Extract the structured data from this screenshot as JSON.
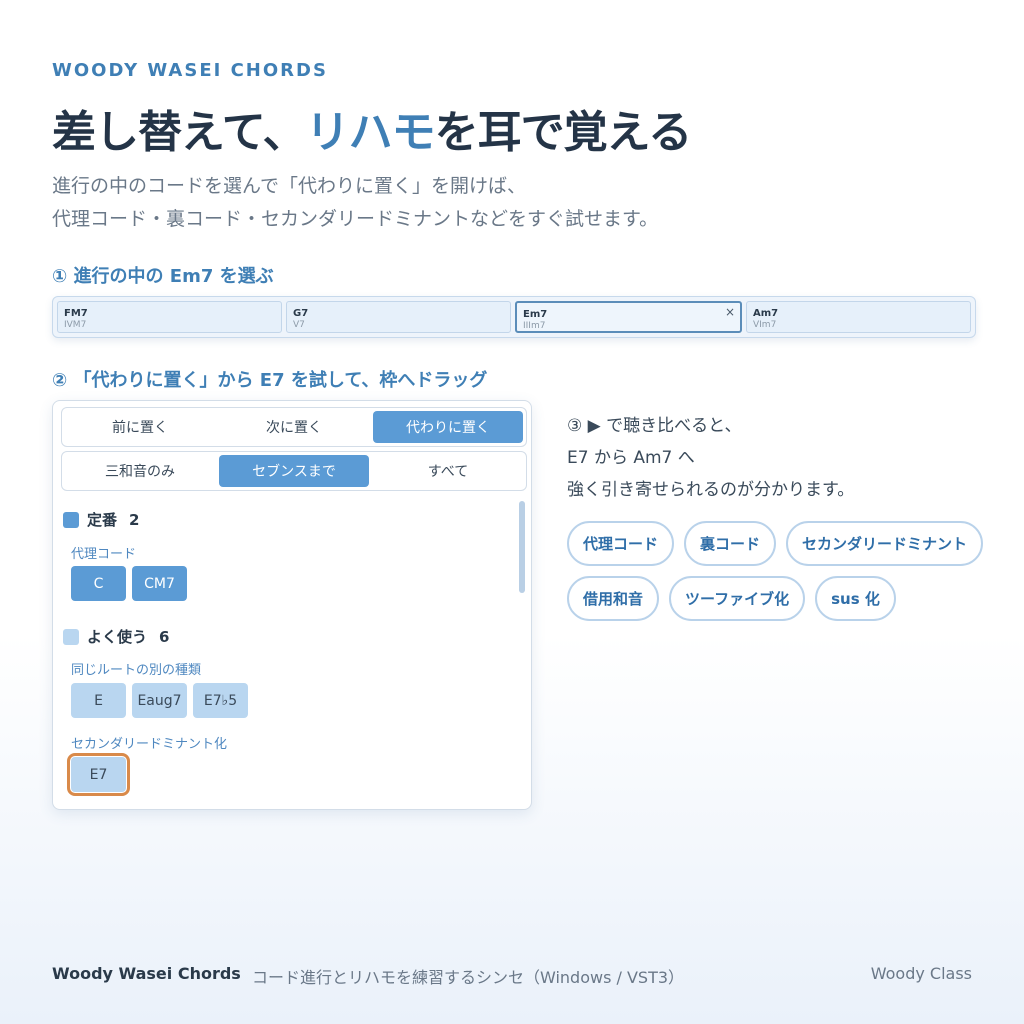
{
  "brand": "WOODY WASEI CHORDS",
  "headline": {
    "before": "差し替えて、",
    "accent": "リハモ",
    "after": "を耳で覚える"
  },
  "lead": {
    "line1": "進行の中のコードを選んで「代わりに置く」を開けば、",
    "line2": "代理コード・裏コード・セカンダリードミナントなどをすぐ試せます。"
  },
  "steps": {
    "step1": "① 進行の中の Em7 を選ぶ",
    "step2": "② 「代わりに置く」から E7 を試して、枠へドラッグ"
  },
  "progression": [
    {
      "name": "FM7",
      "degree": "IVM7"
    },
    {
      "name": "G7",
      "degree": "V7"
    },
    {
      "name": "Em7",
      "degree": "IIIm7",
      "close": "×"
    },
    {
      "name": "Am7",
      "degree": "VIm7"
    }
  ],
  "panel": {
    "place_tabs": [
      "前に置く",
      "次に置く",
      "代わりに置く"
    ],
    "range_tabs": [
      "三和音のみ",
      "セブンスまで",
      "すべて"
    ],
    "standard": {
      "label": "定番",
      "count": "2"
    },
    "substitute": {
      "label": "代理コード",
      "chords": [
        "C",
        "CM7"
      ]
    },
    "common": {
      "label": "よく使う",
      "count": "6"
    },
    "same_root": {
      "label": "同じルートの別の種類",
      "chords": [
        "E",
        "Eaug7",
        "E7♭5"
      ]
    },
    "secondary_dominant": {
      "label": "セカンダリードミナント化",
      "chords": [
        "E7"
      ]
    }
  },
  "compare": {
    "line1": "③ ▶ で聴き比べると、",
    "line2": "E7 から Am7 へ",
    "line3": "強く引き寄せられるのが分かります。"
  },
  "tags": [
    "代理コード",
    "裏コード",
    "セカンダリードミナント",
    "借用和音",
    "ツーファイブ化",
    "sus 化"
  ],
  "footer": {
    "brand": "Woody Wasei Chords",
    "desc": "コード進行とリハモを練習するシンセ（Windows / VST3）",
    "right": "Woody Class"
  },
  "colors": {
    "accent": "#3f7fb5",
    "active": "#5b9bd5",
    "light_chip": "#b9d6f0",
    "highlight": "#d98a4a"
  }
}
